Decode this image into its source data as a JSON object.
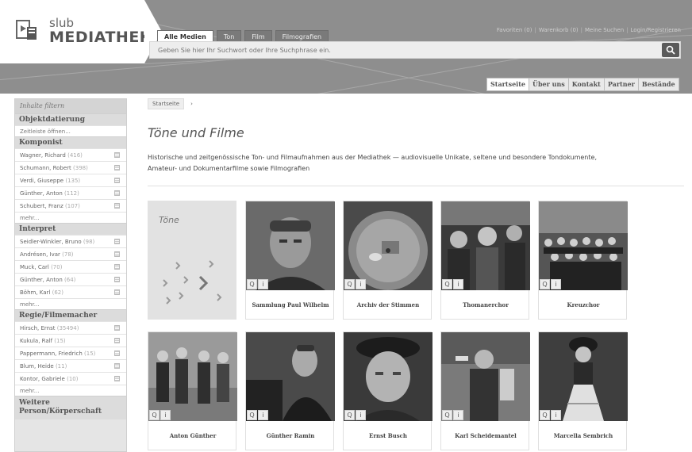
{
  "logo": {
    "small": "slub",
    "big": "MEDIATHEK"
  },
  "tabs": [
    {
      "label": "Alle Medien",
      "active": true
    },
    {
      "label": "Ton",
      "active": false
    },
    {
      "label": "Film",
      "active": false
    },
    {
      "label": "Filmografien",
      "active": false
    }
  ],
  "search": {
    "placeholder": "Geben Sie hier Ihr Suchwort oder Ihre Suchphrase ein."
  },
  "toplinks": [
    "Favoriten (0)",
    "Warenkorb (0)",
    "Meine Suchen",
    "Login/Registrieren"
  ],
  "mainnav": [
    {
      "label": "Startseite",
      "active": true
    },
    {
      "label": "Über uns",
      "active": false
    },
    {
      "label": "Kontakt",
      "active": false
    },
    {
      "label": "Partner",
      "active": false
    },
    {
      "label": "Bestände",
      "active": false
    }
  ],
  "sidebar": {
    "filter_label": "Inhalte filtern",
    "objekt": {
      "title": "Objektdatierung",
      "item": "Zeitleiste öffnen..."
    },
    "komponist": {
      "title": "Komponist",
      "items": [
        {
          "name": "Wagner, Richard",
          "count": "(416)"
        },
        {
          "name": "Schumann, Robert",
          "count": "(398)"
        },
        {
          "name": "Verdi, Giuseppe",
          "count": "(135)"
        },
        {
          "name": "Günther, Anton",
          "count": "(112)"
        },
        {
          "name": "Schubert, Franz",
          "count": "(107)"
        }
      ],
      "more": "mehr..."
    },
    "interpret": {
      "title": "Interpret",
      "items": [
        {
          "name": "Seidler-Winkler, Bruno",
          "count": "(98)"
        },
        {
          "name": "Andrésen, Ivar",
          "count": "(78)"
        },
        {
          "name": "Muck, Carl",
          "count": "(70)"
        },
        {
          "name": "Günther, Anton",
          "count": "(64)"
        },
        {
          "name": "Böhm, Karl",
          "count": "(62)"
        }
      ],
      "more": "mehr..."
    },
    "regie": {
      "title": "Regie/Filmemacher",
      "items": [
        {
          "name": "Hirsch, Ernst",
          "count": "(35494)"
        },
        {
          "name": "Kukula, Ralf",
          "count": "(15)"
        },
        {
          "name": "Pappermann, Friedrich",
          "count": "(15)"
        },
        {
          "name": "Blum, Heide",
          "count": "(11)"
        },
        {
          "name": "Kontor, Gabriele",
          "count": "(10)"
        }
      ],
      "more": "mehr..."
    },
    "weitere": {
      "line1": "Weitere",
      "line2": "Person/Körperschaft"
    }
  },
  "breadcrumb": {
    "home": "Startseite",
    "sep": "›"
  },
  "page": {
    "title": "Töne und Filme",
    "intro": "Historische und zeitgenössische Ton- und Filmaufnahmen aus der Mediathek — audiovisuelle Unikate, seltene und besondere Tondokumente, Amateur- und Dokumentarfilme sowie Filmografien"
  },
  "tone_tile": {
    "title": "Töne"
  },
  "tiles": [
    {
      "caption": "Sammlung Paul Wilhelm"
    },
    {
      "caption": "Archiv der Stimmen"
    },
    {
      "caption": "Thomanerchor"
    },
    {
      "caption": "Kreuzchor"
    },
    {
      "caption": "Anton Günther"
    },
    {
      "caption": "Günther Ramin"
    },
    {
      "caption": "Ernst Busch"
    },
    {
      "caption": "Karl Scheidemantel"
    },
    {
      "caption": "Marcella Sembrich"
    }
  ],
  "badges": {
    "search": "Q",
    "info": "i"
  },
  "colors": {
    "header_bg": "#8e8e8e",
    "sidebar_bg": "#e5e5e5",
    "accent_dark": "#5a5a5a"
  }
}
